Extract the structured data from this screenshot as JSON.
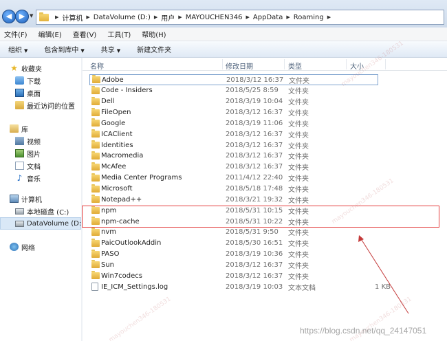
{
  "address": {
    "crumbs": [
      "计算机",
      "DataVolume (D:)",
      "用户",
      "MAYOUCHEN346",
      "AppData",
      "Roaming"
    ]
  },
  "menu": [
    "文件(F)",
    "编辑(E)",
    "查看(V)",
    "工具(T)",
    "帮助(H)"
  ],
  "toolbar": {
    "organize": "组织",
    "include": "包含到库中",
    "share": "共享",
    "new_folder": "新建文件夹"
  },
  "sidebar": {
    "favorites": "收藏夹",
    "downloads": "下载",
    "desktop": "桌面",
    "recent": "最近访问的位置",
    "libraries": "库",
    "videos": "视频",
    "pictures": "图片",
    "documents": "文档",
    "music": "音乐",
    "computer": "计算机",
    "drive_c": "本地磁盘 (C:)",
    "drive_d": "DataVolume (D:)",
    "network": "网络"
  },
  "columns": {
    "name": "名称",
    "date": "修改日期",
    "type": "类型",
    "size": "大小"
  },
  "files": [
    {
      "name": "Adobe",
      "date": "2018/3/12 16:37",
      "type": "文件夹",
      "size": "",
      "kind": "folder"
    },
    {
      "name": "Code - Insiders",
      "date": "2018/5/25 8:59",
      "type": "文件夹",
      "size": "",
      "kind": "folder"
    },
    {
      "name": "Dell",
      "date": "2018/3/19 10:04",
      "type": "文件夹",
      "size": "",
      "kind": "folder"
    },
    {
      "name": "FileOpen",
      "date": "2018/3/12 16:37",
      "type": "文件夹",
      "size": "",
      "kind": "folder"
    },
    {
      "name": "Google",
      "date": "2018/3/19 11:06",
      "type": "文件夹",
      "size": "",
      "kind": "folder"
    },
    {
      "name": "ICAClient",
      "date": "2018/3/12 16:37",
      "type": "文件夹",
      "size": "",
      "kind": "folder"
    },
    {
      "name": "Identities",
      "date": "2018/3/12 16:37",
      "type": "文件夹",
      "size": "",
      "kind": "folder"
    },
    {
      "name": "Macromedia",
      "date": "2018/3/12 16:37",
      "type": "文件夹",
      "size": "",
      "kind": "folder"
    },
    {
      "name": "McAfee",
      "date": "2018/3/12 16:37",
      "type": "文件夹",
      "size": "",
      "kind": "folder"
    },
    {
      "name": "Media Center Programs",
      "date": "2011/4/12 22:40",
      "type": "文件夹",
      "size": "",
      "kind": "folder"
    },
    {
      "name": "Microsoft",
      "date": "2018/5/18 17:48",
      "type": "文件夹",
      "size": "",
      "kind": "folder"
    },
    {
      "name": "Notepad++",
      "date": "2018/3/21 19:32",
      "type": "文件夹",
      "size": "",
      "kind": "folder"
    },
    {
      "name": "npm",
      "date": "2018/5/31 10:15",
      "type": "文件夹",
      "size": "",
      "kind": "folder"
    },
    {
      "name": "npm-cache",
      "date": "2018/5/31 10:22",
      "type": "文件夹",
      "size": "",
      "kind": "folder"
    },
    {
      "name": "nvm",
      "date": "2018/5/31 9:50",
      "type": "文件夹",
      "size": "",
      "kind": "folder"
    },
    {
      "name": "PaicOutlookAddin",
      "date": "2018/5/30 16:51",
      "type": "文件夹",
      "size": "",
      "kind": "folder"
    },
    {
      "name": "PASO",
      "date": "2018/3/19 10:36",
      "type": "文件夹",
      "size": "",
      "kind": "folder"
    },
    {
      "name": "Sun",
      "date": "2018/3/12 16:37",
      "type": "文件夹",
      "size": "",
      "kind": "folder"
    },
    {
      "name": "Win7codecs",
      "date": "2018/3/12 16:37",
      "type": "文件夹",
      "size": "",
      "kind": "folder"
    },
    {
      "name": "IE_ICM_Settings.log",
      "date": "2018/3/19 10:03",
      "type": "文本文档",
      "size": "1 KB",
      "kind": "file"
    }
  ],
  "blog_watermark": "https://blog.csdn.net/qq_24147051",
  "colors": {
    "highlight_box": "#e33b3b",
    "arrow": "#c43a3a"
  }
}
